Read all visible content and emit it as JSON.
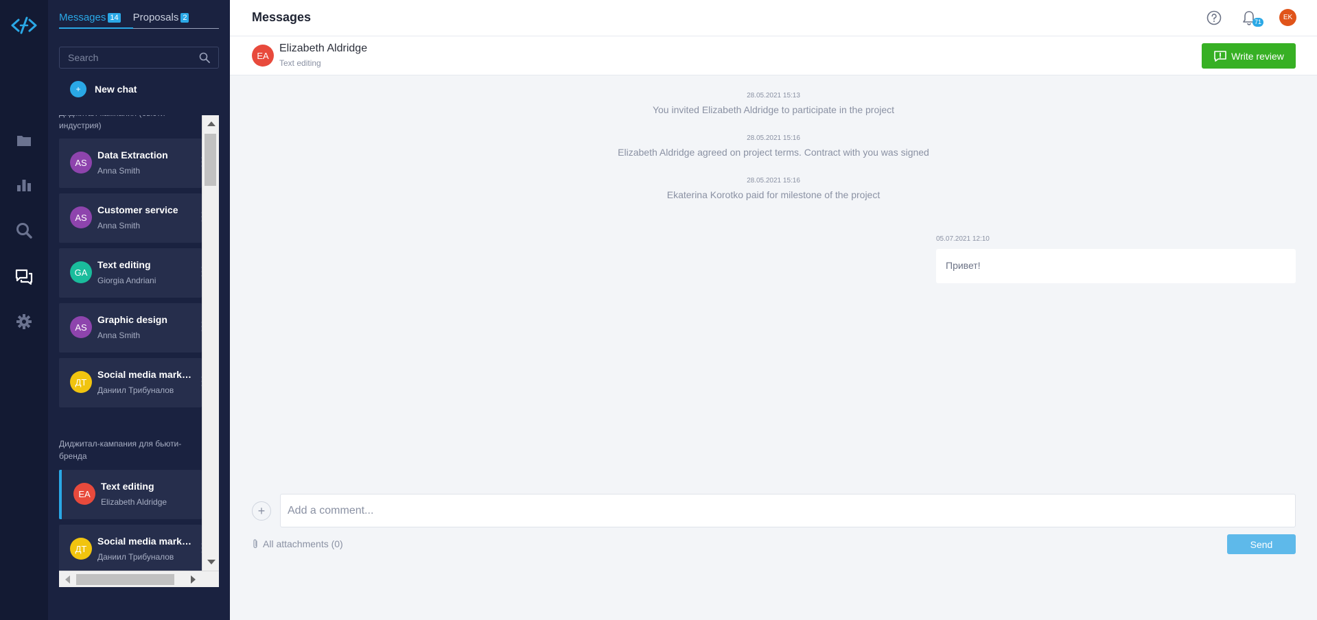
{
  "rail": {
    "items": [
      "logo-icon",
      "folder-icon",
      "chart-icon",
      "search-icon",
      "chat-icon",
      "gear-icon"
    ]
  },
  "panel": {
    "tabs": [
      {
        "label": "Messages",
        "badge": "14"
      },
      {
        "label": "Proposals",
        "badge": "2"
      }
    ],
    "search_placeholder": "Search",
    "new_chat_label": "New chat",
    "new_chat_plus": "+",
    "groups": [
      {
        "title": "Диджитал-кампания (бьюти-индустрия)",
        "chats": [
          {
            "initials": "AS",
            "title": "Data Extraction",
            "person": "Anna Smith",
            "color": "#8e44ad"
          },
          {
            "initials": "AS",
            "title": "Customer service",
            "person": "Anna Smith",
            "color": "#8e44ad"
          },
          {
            "initials": "GA",
            "title": "Text editing",
            "person": "Giorgia Andriani",
            "color": "#1abc9c"
          },
          {
            "initials": "AS",
            "title": "Graphic design",
            "person": "Anna Smith",
            "color": "#8e44ad"
          },
          {
            "initials": "ДТ",
            "title": "Social media marketing",
            "person": "Даниил Трибуналов",
            "color": "#f1c40f"
          }
        ]
      },
      {
        "title": "Диджитал-кампания для бьюти-бренда",
        "chats": [
          {
            "initials": "EA",
            "title": "Text editing",
            "person": "Elizabeth Aldridge",
            "color": "#e84a3c",
            "active": true
          },
          {
            "initials": "ДТ",
            "title": "Social media marketing",
            "person": "Даниил Трибуналов",
            "color": "#f1c40f"
          }
        ]
      }
    ]
  },
  "topbar": {
    "title": "Messages",
    "notifications_count": "71",
    "user_initials": "EK",
    "user_color": "#e0541a"
  },
  "chat_header": {
    "initials": "EA",
    "name": "Elizabeth Aldridge",
    "project": "Text editing",
    "write_review_label": "Write review",
    "button_color": "#37b024"
  },
  "system_messages": [
    {
      "time": "28.05.2021 15:13",
      "text": "You invited Elizabeth Aldridge to participate in the project"
    },
    {
      "time": "28.05.2021 15:16",
      "text": "Elizabeth Aldridge agreed on project terms. Contract with you was signed"
    },
    {
      "time": "28.05.2021 15:16",
      "text": "Ekaterina Korotko paid for milestone of the project"
    }
  ],
  "messages": [
    {
      "time": "05.07.2021 12:10",
      "text": "Привет!"
    }
  ],
  "composer": {
    "placeholder": "Add a comment...",
    "value": "",
    "plus": "+",
    "attachments_label": "All attachments (0)",
    "send_label": "Send",
    "send_color": "#5eb9ea"
  }
}
